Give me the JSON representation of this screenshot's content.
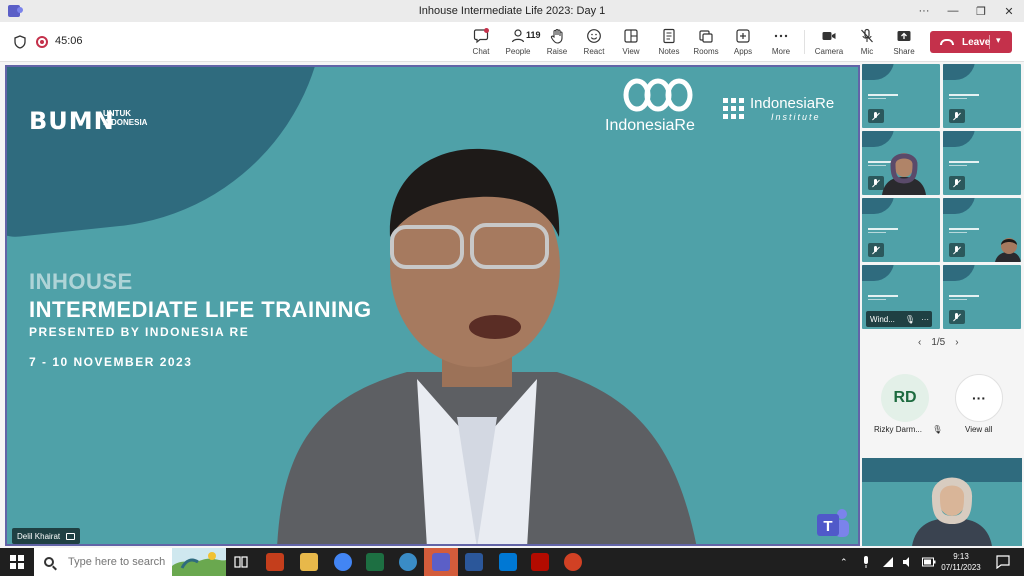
{
  "window": {
    "title": "Inhouse Intermediate Life 2023: Day 1",
    "controls": [
      "···",
      "—",
      "❐",
      "✕"
    ]
  },
  "toolbar": {
    "timer": "45:06",
    "buttons": [
      {
        "name": "chat",
        "label": "Chat",
        "icon": "chat-icon"
      },
      {
        "name": "people",
        "label": "People",
        "icon": "people-icon",
        "count": "119"
      },
      {
        "name": "raise",
        "label": "Raise",
        "icon": "hand-icon"
      },
      {
        "name": "react",
        "label": "React",
        "icon": "smiley-icon"
      },
      {
        "name": "view",
        "label": "View",
        "icon": "view-grid-icon"
      },
      {
        "name": "notes",
        "label": "Notes",
        "icon": "notes-icon"
      },
      {
        "name": "rooms",
        "label": "Rooms",
        "icon": "rooms-icon"
      },
      {
        "name": "apps",
        "label": "Apps",
        "icon": "plus-icon"
      },
      {
        "name": "more",
        "label": "More",
        "icon": "ellipsis-icon"
      },
      {
        "name": "camera",
        "label": "Camera",
        "icon": "camera-icon"
      },
      {
        "name": "mic",
        "label": "Mic",
        "icon": "mic-off-icon"
      },
      {
        "name": "share",
        "label": "Share",
        "icon": "share-icon"
      }
    ],
    "leave_label": "Leave"
  },
  "main": {
    "slide": {
      "brand_left": "BUMN",
      "brand_left_sub": "UNTUK INDONESIA",
      "brand_center": "IndonesiaRe",
      "brand_right_1": "IndonesiaRe",
      "brand_right_2": "Institute",
      "line1": "INHOUSE",
      "line2": "INTERMEDIATE LIFE TRAINING",
      "line3": "PRESENTED BY INDONESIA RE",
      "line4": "7 - 10 NOVEMBER 2023"
    },
    "speaker_name": "Delil Khairat"
  },
  "sidebar": {
    "tile_name": "Wind...",
    "pager": {
      "prev": "‹",
      "page": "1/5",
      "next": "›"
    },
    "participant": {
      "initials": "RD",
      "name": "Rizky Darm..."
    },
    "view_all": "View all"
  },
  "taskbar": {
    "search_placeholder": "Type here to search",
    "time": "9:13",
    "date": "07/11/2023"
  },
  "colors": {
    "teams_purple": "#6264a7",
    "leave_red": "#c4314b",
    "slide_teal": "#4fa1a8",
    "slide_dark": "#2f6b7e"
  }
}
